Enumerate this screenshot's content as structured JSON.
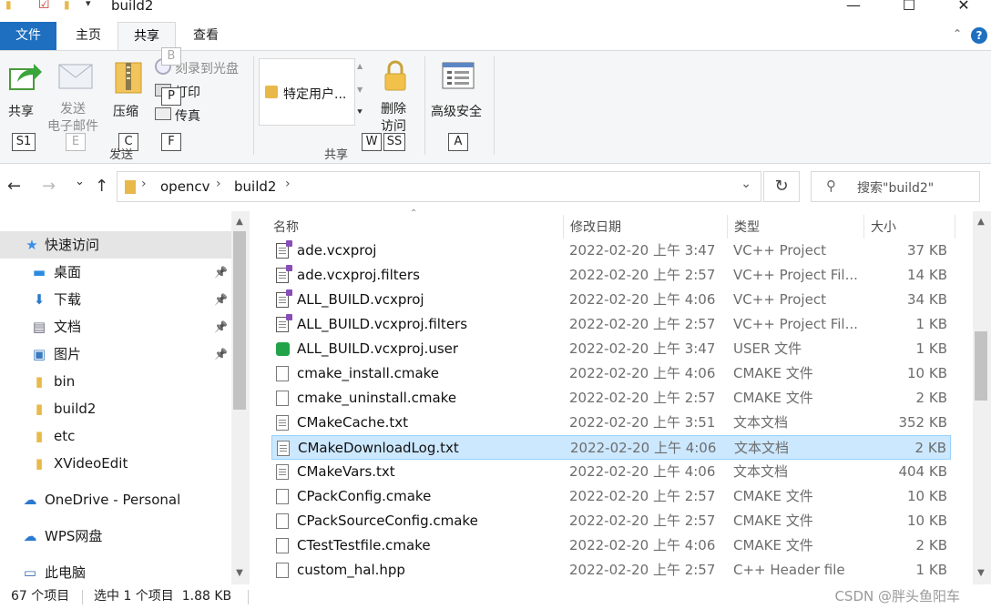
{
  "window": {
    "title": "build2",
    "controls": {
      "minimize": "—",
      "maximize": "☐",
      "close": "✕"
    }
  },
  "ribbon_tabs": [
    {
      "label": "文件"
    },
    {
      "label": "主页"
    },
    {
      "label": "共享"
    },
    {
      "label": "查看"
    }
  ],
  "ribbon": {
    "share": {
      "label": "共享",
      "keytip": "S1"
    },
    "email": {
      "label1": "发送",
      "label2": "电子邮件",
      "keytip": "E"
    },
    "zip": {
      "label": "压缩",
      "keytip": "C"
    },
    "burn": {
      "label": "刻录到光盘",
      "keytip": "B"
    },
    "print": {
      "label": "打印",
      "keytip": "P"
    },
    "fax": {
      "label": "传真",
      "keytip": "F"
    },
    "send_group_label": "发送",
    "share_with": {
      "label": "特定用户...",
      "keytip": "W"
    },
    "remove_access": {
      "label1": "删除",
      "label2": "访问",
      "keytip": "SS"
    },
    "share_group_label": "共享",
    "advanced_security": {
      "label": "高级安全",
      "keytip": "A"
    }
  },
  "address": {
    "segments": [
      "opencv",
      "build2"
    ],
    "search_placeholder": "搜索\"build2\""
  },
  "nav": {
    "items": [
      {
        "label": "快速访问",
        "icon": "star-icon",
        "selected": true,
        "pinned": false
      },
      {
        "label": "桌面",
        "icon": "desktop-icon",
        "selected": false,
        "pinned": true
      },
      {
        "label": "下载",
        "icon": "download-icon",
        "selected": false,
        "pinned": true
      },
      {
        "label": "文档",
        "icon": "document-icon",
        "selected": false,
        "pinned": true
      },
      {
        "label": "图片",
        "icon": "picture-icon",
        "selected": false,
        "pinned": true
      },
      {
        "label": "bin",
        "icon": "folder-icon",
        "selected": false,
        "pinned": false
      },
      {
        "label": "build2",
        "icon": "folder-icon",
        "selected": false,
        "pinned": false
      },
      {
        "label": "etc",
        "icon": "folder-icon",
        "selected": false,
        "pinned": false
      },
      {
        "label": "XVideoEdit",
        "icon": "folder-icon",
        "selected": false,
        "pinned": false
      },
      {
        "label": "OneDrive - Personal",
        "icon": "cloud-icon",
        "selected": false,
        "pinned": false
      },
      {
        "label": "WPS网盘",
        "icon": "cloud-icon",
        "selected": false,
        "pinned": false
      },
      {
        "label": "此电脑",
        "icon": "computer-icon",
        "selected": false,
        "pinned": false
      }
    ]
  },
  "columns": {
    "name": "名称",
    "date": "修改日期",
    "type": "类型",
    "size": "大小"
  },
  "files": [
    {
      "name": "ade.vcxproj",
      "date": "2022-02-20 上午 3:47",
      "type": "VC++ Project",
      "size": "37 KB",
      "kind": "proj"
    },
    {
      "name": "ade.vcxproj.filters",
      "date": "2022-02-20 上午 2:57",
      "type": "VC++ Project Fil...",
      "size": "14 KB",
      "kind": "proj"
    },
    {
      "name": "ALL_BUILD.vcxproj",
      "date": "2022-02-20 上午 4:06",
      "type": "VC++ Project",
      "size": "34 KB",
      "kind": "proj"
    },
    {
      "name": "ALL_BUILD.vcxproj.filters",
      "date": "2022-02-20 上午 2:57",
      "type": "VC++ Project Fil...",
      "size": "1 KB",
      "kind": "proj"
    },
    {
      "name": "ALL_BUILD.vcxproj.user",
      "date": "2022-02-20 上午 3:47",
      "type": "USER 文件",
      "size": "1 KB",
      "kind": "user"
    },
    {
      "name": "cmake_install.cmake",
      "date": "2022-02-20 上午 4:06",
      "type": "CMAKE 文件",
      "size": "10 KB",
      "kind": "file"
    },
    {
      "name": "cmake_uninstall.cmake",
      "date": "2022-02-20 上午 2:57",
      "type": "CMAKE 文件",
      "size": "2 KB",
      "kind": "file"
    },
    {
      "name": "CMakeCache.txt",
      "date": "2022-02-20 上午 3:51",
      "type": "文本文档",
      "size": "352 KB",
      "kind": "text"
    },
    {
      "name": "CMakeDownloadLog.txt",
      "date": "2022-02-20 上午 4:06",
      "type": "文本文档",
      "size": "2 KB",
      "kind": "text",
      "selected": true
    },
    {
      "name": "CMakeVars.txt",
      "date": "2022-02-20 上午 4:06",
      "type": "文本文档",
      "size": "404 KB",
      "kind": "text"
    },
    {
      "name": "CPackConfig.cmake",
      "date": "2022-02-20 上午 2:57",
      "type": "CMAKE 文件",
      "size": "10 KB",
      "kind": "file"
    },
    {
      "name": "CPackSourceConfig.cmake",
      "date": "2022-02-20 上午 2:57",
      "type": "CMAKE 文件",
      "size": "10 KB",
      "kind": "file"
    },
    {
      "name": "CTestTestfile.cmake",
      "date": "2022-02-20 上午 4:06",
      "type": "CMAKE 文件",
      "size": "2 KB",
      "kind": "file"
    },
    {
      "name": "custom_hal.hpp",
      "date": "2022-02-20 上午 2:57",
      "type": "C++ Header file",
      "size": "1 KB",
      "kind": "file"
    }
  ],
  "status": {
    "count": "67 个项目",
    "selection": "选中 1 个项目  1.88 KB"
  },
  "watermark": "CSDN @胖头鱼阳车"
}
